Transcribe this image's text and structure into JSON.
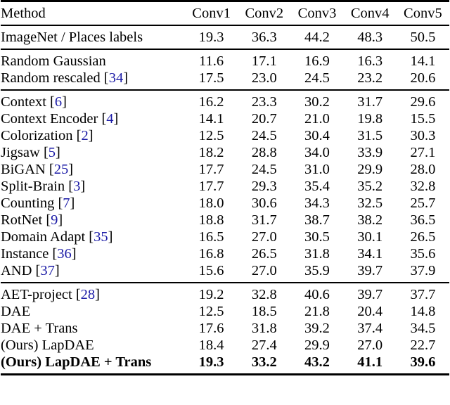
{
  "table": {
    "columns": [
      "Method",
      "Conv1",
      "Conv2",
      "Conv3",
      "Conv4",
      "Conv5"
    ],
    "cite_color": "#1a1aa6",
    "sections": [
      {
        "name": "supervised-baseline",
        "rows": [
          {
            "method": "ImageNet / Places labels",
            "citation": "",
            "values": [
              "19.3",
              "36.3",
              "44.2",
              "48.3",
              "50.5"
            ],
            "bold": false
          }
        ]
      },
      {
        "name": "random-baselines",
        "rows": [
          {
            "method": "Random Gaussian",
            "citation": "",
            "values": [
              "11.6",
              "17.1",
              "16.9",
              "16.3",
              "14.1"
            ],
            "bold": false
          },
          {
            "method": "Random rescaled",
            "citation": "34",
            "values": [
              "17.5",
              "23.0",
              "24.5",
              "23.2",
              "20.6"
            ],
            "bold": false
          }
        ]
      },
      {
        "name": "self-supervised-prior-work",
        "rows": [
          {
            "method": "Context",
            "citation": "6",
            "values": [
              "16.2",
              "23.3",
              "30.2",
              "31.7",
              "29.6"
            ],
            "bold": false
          },
          {
            "method": "Context Encoder",
            "citation": "4",
            "values": [
              "14.1",
              "20.7",
              "21.0",
              "19.8",
              "15.5"
            ],
            "bold": false
          },
          {
            "method": "Colorization",
            "citation": "2",
            "values": [
              "12.5",
              "24.5",
              "30.4",
              "31.5",
              "30.3"
            ],
            "bold": false
          },
          {
            "method": "Jigsaw",
            "citation": "5",
            "values": [
              "18.2",
              "28.8",
              "34.0",
              "33.9",
              "27.1"
            ],
            "bold": false
          },
          {
            "method": "BiGAN",
            "citation": "25",
            "values": [
              "17.7",
              "24.5",
              "31.0",
              "29.9",
              "28.0"
            ],
            "bold": false
          },
          {
            "method": "Split-Brain",
            "citation": "3",
            "values": [
              "17.7",
              "29.3",
              "35.4",
              "35.2",
              "32.8"
            ],
            "bold": false
          },
          {
            "method": "Counting",
            "citation": "7",
            "values": [
              "18.0",
              "30.6",
              "34.3",
              "32.5",
              "25.7"
            ],
            "bold": false
          },
          {
            "method": "RotNet",
            "citation": "9",
            "values": [
              "18.8",
              "31.7",
              "38.7",
              "38.2",
              "36.5"
            ],
            "bold": false
          },
          {
            "method": "Domain Adapt",
            "citation": "35",
            "values": [
              "16.5",
              "27.0",
              "30.5",
              "30.1",
              "26.5"
            ],
            "bold": false
          },
          {
            "method": "Instance",
            "citation": "36",
            "values": [
              "16.8",
              "26.5",
              "31.8",
              "34.1",
              "35.6"
            ],
            "bold": false
          },
          {
            "method": "AND",
            "citation": "37",
            "values": [
              "15.6",
              "27.0",
              "35.9",
              "39.7",
              "37.9"
            ],
            "bold": false
          }
        ]
      },
      {
        "name": "ours-and-ablations",
        "rows": [
          {
            "method": "AET-project",
            "citation": "28",
            "values": [
              "19.2",
              "32.8",
              "40.6",
              "39.7",
              "37.7"
            ],
            "bold": false
          },
          {
            "method": "DAE",
            "citation": "",
            "values": [
              "12.5",
              "18.5",
              "21.8",
              "20.4",
              "14.8"
            ],
            "bold": false
          },
          {
            "method": "DAE + Trans",
            "citation": "",
            "values": [
              "17.6",
              "31.8",
              "39.2",
              "37.4",
              "34.5"
            ],
            "bold": false
          },
          {
            "method": "(Ours) LapDAE",
            "citation": "",
            "values": [
              "18.4",
              "27.4",
              "29.9",
              "27.0",
              "22.7"
            ],
            "bold": false
          },
          {
            "method": "(Ours) LapDAE + Trans",
            "citation": "",
            "values": [
              "19.3",
              "33.2",
              "43.2",
              "41.1",
              "39.6"
            ],
            "bold": true
          }
        ]
      }
    ]
  }
}
